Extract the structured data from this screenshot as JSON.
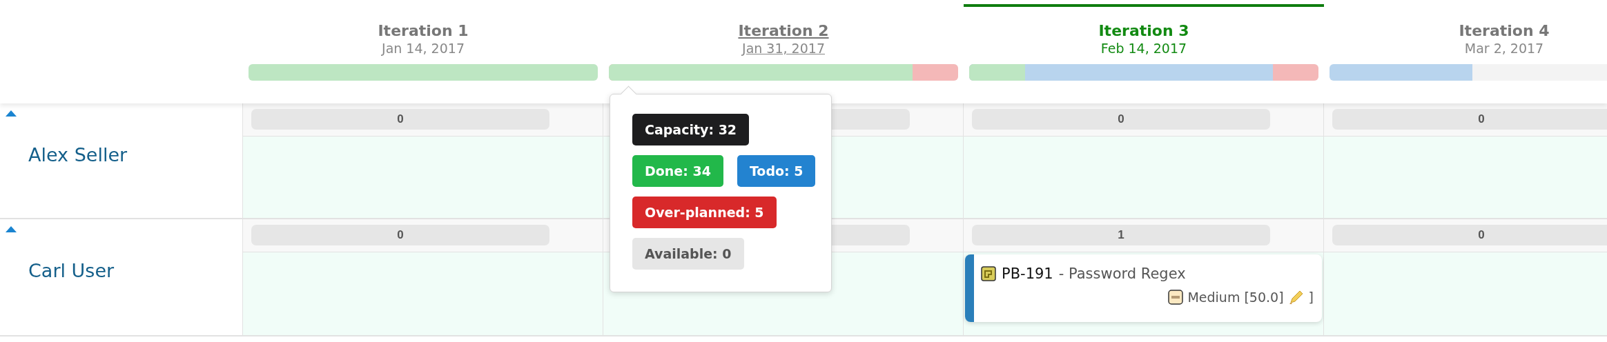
{
  "iterations": [
    {
      "title": "Iteration 1",
      "date": "Jan 14, 2017",
      "selected": false,
      "hovered": false,
      "bar": [
        {
          "kind": "done",
          "level": 1
        }
      ]
    },
    {
      "title": "Iteration 2",
      "date": "Jan 31, 2017",
      "selected": false,
      "hovered": true,
      "bar": [
        {
          "kind": "done",
          "level": 0.87
        },
        {
          "kind": "over",
          "level": 1
        }
      ]
    },
    {
      "title": "Iteration 3",
      "date": "Feb 14, 2017",
      "selected": true,
      "hovered": false,
      "bar": [
        {
          "kind": "done",
          "level": 0.16
        },
        {
          "kind": "todo",
          "level": 0.87
        },
        {
          "kind": "over",
          "level": 1
        }
      ]
    },
    {
      "title": "Iteration 4",
      "date": "Mar 2, 2017",
      "selected": false,
      "hovered": false,
      "bar": [
        {
          "kind": "todo",
          "level": 0.41
        }
      ]
    }
  ],
  "rows": [
    {
      "name": "Alex Seller",
      "expanded": true,
      "cells": [
        {
          "count": "0"
        },
        {},
        {
          "count": "0"
        },
        {
          "count": "0"
        }
      ]
    },
    {
      "name": "Carl User",
      "expanded": true,
      "cells": [
        {
          "count": "0"
        },
        {},
        {
          "count": "1",
          "cards": [
            {
              "key": "PB-191",
              "title": "- Password Regex",
              "priority": "Medium [50.0]",
              "suffix": "]"
            }
          ]
        },
        {
          "count": "0"
        }
      ]
    }
  ],
  "popover": {
    "lines": [
      [
        {
          "kind": "capacity",
          "label": "Capacity: 32"
        }
      ],
      [
        {
          "kind": "done",
          "label": "Done: 34"
        },
        {
          "kind": "todo",
          "label": "Todo: 5"
        }
      ],
      [
        {
          "kind": "over",
          "label": "Over-planned: 5"
        }
      ],
      [
        {
          "kind": "available",
          "label": "Available: 0"
        }
      ]
    ]
  }
}
